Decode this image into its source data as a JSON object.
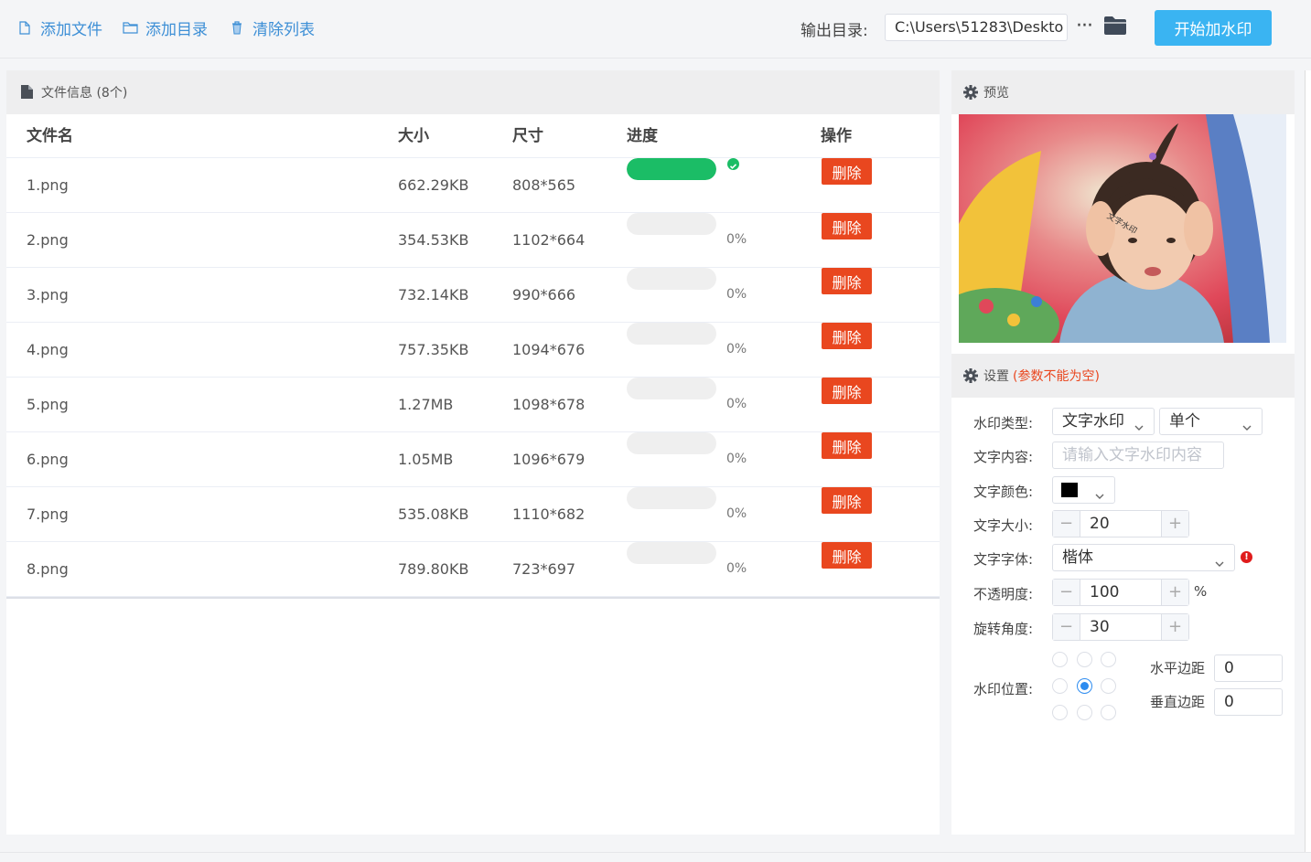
{
  "toolbar": {
    "add_file": "添加文件",
    "add_dir": "添加目录",
    "clear_list": "清除列表",
    "output_label": "输出目录:",
    "output_path": "C:\\Users\\51283\\Deskto",
    "more": "···",
    "start": "开始加水印"
  },
  "file_panel": {
    "title": "文件信息 (8个)",
    "columns": [
      "文件名",
      "大小",
      "尺寸",
      "进度",
      "操作"
    ],
    "delete_label": "删除",
    "rows": [
      {
        "name": "1.png",
        "size": "662.29KB",
        "dim": "808*565",
        "progress": 1.0,
        "pct": ""
      },
      {
        "name": "2.png",
        "size": "354.53KB",
        "dim": "1102*664",
        "progress": 0,
        "pct": "0%"
      },
      {
        "name": "3.png",
        "size": "732.14KB",
        "dim": "990*666",
        "progress": 0,
        "pct": "0%"
      },
      {
        "name": "4.png",
        "size": "757.35KB",
        "dim": "1094*676",
        "progress": 0,
        "pct": "0%"
      },
      {
        "name": "5.png",
        "size": "1.27MB",
        "dim": "1098*678",
        "progress": 0,
        "pct": "0%"
      },
      {
        "name": "6.png",
        "size": "1.05MB",
        "dim": "1096*679",
        "progress": 0,
        "pct": "0%"
      },
      {
        "name": "7.png",
        "size": "535.08KB",
        "dim": "1110*682",
        "progress": 0,
        "pct": "0%"
      },
      {
        "name": "8.png",
        "size": "789.80KB",
        "dim": "723*697",
        "progress": 0,
        "pct": "0%"
      }
    ]
  },
  "preview": {
    "title": "预览",
    "watermark_text": "文字水印"
  },
  "settings": {
    "title": "设置",
    "note": "(参数不能为空)",
    "type_label": "水印类型:",
    "type_value": "文字水印",
    "mode_value": "单个",
    "content_label": "文字内容:",
    "content_placeholder": "请输入文字水印内容",
    "color_label": "文字颜色:",
    "color_value": "#000000",
    "size_label": "文字大小:",
    "size_value": "20",
    "font_label": "文字字体:",
    "font_value": "楷体",
    "opacity_label": "不透明度:",
    "opacity_value": "100",
    "opacity_unit": "%",
    "rotate_label": "旋转角度:",
    "rotate_value": "30",
    "position_label": "水印位置:",
    "position_selected": 4,
    "h_margin_label": "水平边距",
    "h_margin_value": "0",
    "v_margin_label": "垂直边距",
    "v_margin_value": "0",
    "minus": "−",
    "plus": "+"
  },
  "colors": {
    "accent": "#3d8fd6",
    "primary_button": "#3ab4f2",
    "delete": "#e9471f",
    "progress_done": "#1bbd66"
  }
}
